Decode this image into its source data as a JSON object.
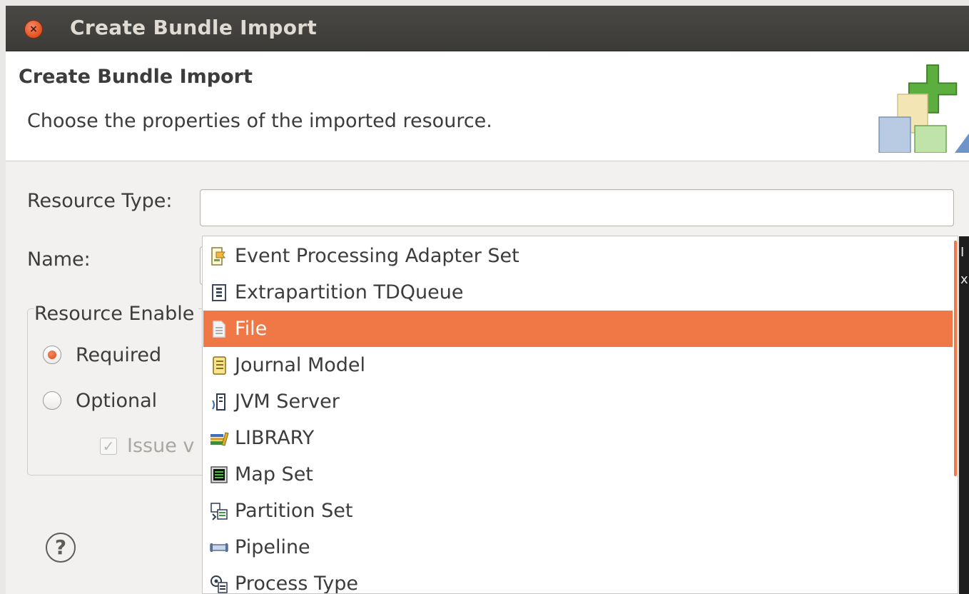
{
  "window": {
    "title": "Create Bundle Import"
  },
  "header": {
    "title": "Create Bundle Import",
    "description": "Choose the properties of the imported resource.",
    "icon": "wizard-import-icon"
  },
  "form": {
    "resource_type_label": "Resource Type:",
    "resource_type_value": "",
    "name_label": "Name:",
    "group_label": "Resource Enable",
    "radios": [
      {
        "label": "Required",
        "checked": true
      },
      {
        "label": "Optional",
        "checked": false
      }
    ],
    "checkbox_label": "Issue v",
    "checkbox_checked": true,
    "checkbox_enabled": false
  },
  "dropdown": {
    "items": [
      {
        "label": "Event Processing Adapter Set",
        "icon": "event-adapter-icon",
        "selected": false
      },
      {
        "label": "Extrapartition TDQueue",
        "icon": "tdqueue-icon",
        "selected": false
      },
      {
        "label": "File",
        "icon": "file-icon",
        "selected": true
      },
      {
        "label": "Journal Model",
        "icon": "journal-icon",
        "selected": false
      },
      {
        "label": "JVM Server",
        "icon": "jvm-server-icon",
        "selected": false
      },
      {
        "label": "LIBRARY",
        "icon": "library-icon",
        "selected": false
      },
      {
        "label": "Map Set",
        "icon": "map-set-icon",
        "selected": false
      },
      {
        "label": "Partition Set",
        "icon": "partition-set-icon",
        "selected": false
      },
      {
        "label": "Pipeline",
        "icon": "pipeline-icon",
        "selected": false
      },
      {
        "label": "Process Type",
        "icon": "process-type-icon",
        "selected": false
      }
    ],
    "accent_color": "#f07746"
  },
  "background_window_glyphs": [
    "I",
    "x"
  ],
  "help": {
    "glyph": "?"
  },
  "close_glyph": "×"
}
